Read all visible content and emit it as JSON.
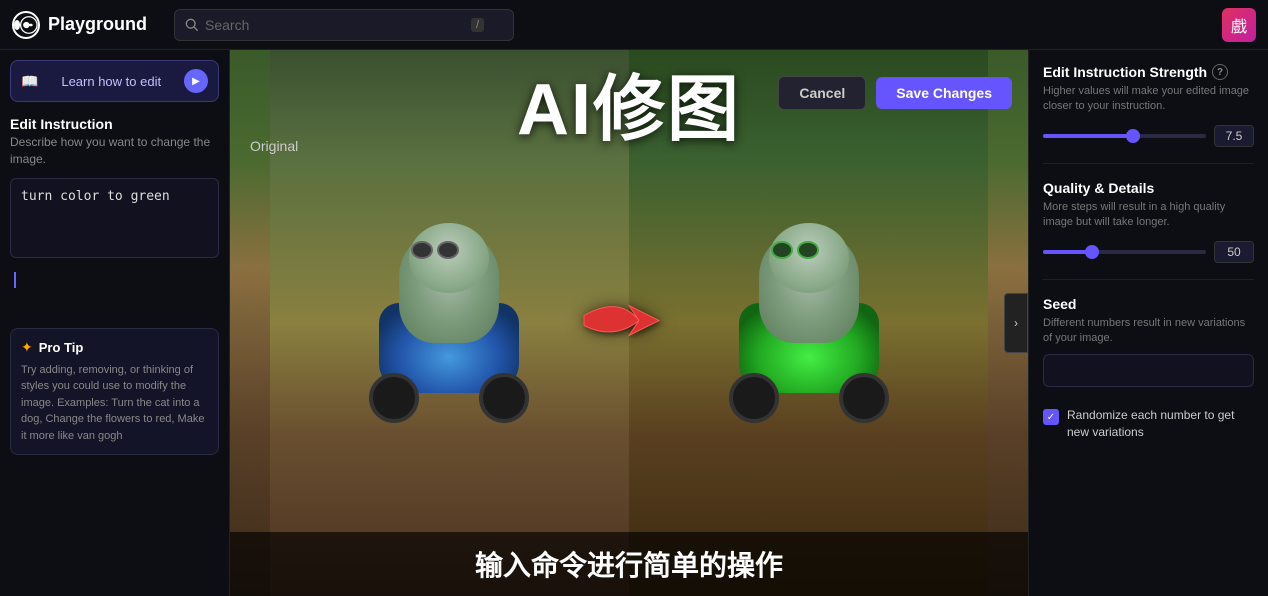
{
  "topnav": {
    "logo_text": "Playground",
    "search_placeholder": "Search",
    "search_shortcut": "/",
    "avatar_emoji": "戲"
  },
  "left_sidebar": {
    "learn_btn_label": "Learn how to edit",
    "learn_btn_play_icon": "▶",
    "edit_instruction_title": "Edit Instruction",
    "edit_instruction_desc": "Describe how you want to change the image.",
    "instruction_value": "turn color to green",
    "pro_tip_title": "Pro Tip",
    "pro_tip_icon": "✦",
    "pro_tip_text": "Try adding, removing, or thinking of styles you could use to modify the image. Examples: Turn the cat into a dog, Change the flowers to red, Make it more like van gogh"
  },
  "center_panel": {
    "overlay_title": "AI修图",
    "cancel_label": "Cancel",
    "save_label": "Save Changes",
    "original_label": "Original",
    "overlay_subtitle": "输入命令进行简单的操作",
    "chevron_icon": "›"
  },
  "right_sidebar": {
    "strength_title": "Edit Instruction Strength",
    "strength_info": "?",
    "strength_desc": "Higher values will make your edited image closer to your instruction.",
    "strength_value": "7.5",
    "strength_percent": 55,
    "quality_title": "Quality & Details",
    "quality_desc": "More steps will result in a high quality image but will take longer.",
    "quality_value": "50",
    "quality_percent": 30,
    "seed_title": "Seed",
    "seed_desc": "Different numbers result in new variations of your image.",
    "seed_placeholder": "",
    "randomize_label": "Randomize each number to get new variations",
    "checkbox_checked": "✓"
  }
}
